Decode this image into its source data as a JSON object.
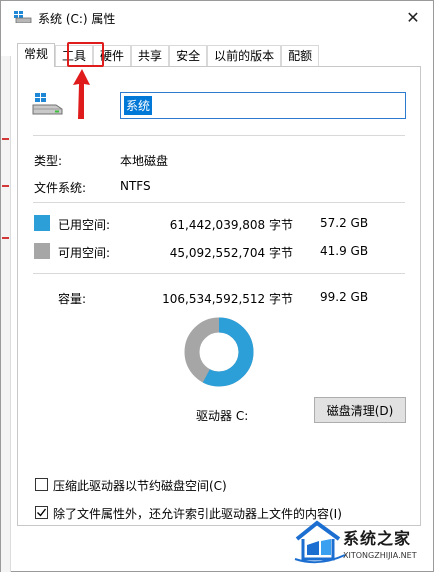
{
  "window": {
    "title": "系统 (C:) 属性",
    "close_symbol": "✕"
  },
  "tabs": [
    {
      "label": "常规",
      "active": true
    },
    {
      "label": "工具",
      "active": false,
      "highlighted": true
    },
    {
      "label": "硬件",
      "active": false
    },
    {
      "label": "共享",
      "active": false
    },
    {
      "label": "安全",
      "active": false
    },
    {
      "label": "以前的版本",
      "active": false
    },
    {
      "label": "配额",
      "active": false
    }
  ],
  "drive": {
    "icon": "drive-icon",
    "name": "系统"
  },
  "info": {
    "type_label": "类型:",
    "type_value": "本地磁盘",
    "fs_label": "文件系统:",
    "fs_value": "NTFS"
  },
  "space": {
    "used_label": "已用空间:",
    "used_bytes": "61,442,039,808 字节",
    "used_gb": "57.2 GB",
    "free_label": "可用空间:",
    "free_bytes": "45,092,552,704 字节",
    "free_gb": "41.9 GB",
    "capacity_label": "容量:",
    "capacity_bytes": "106,534,592,512 字节",
    "capacity_gb": "99.2 GB",
    "used_fraction": 0.577
  },
  "colors": {
    "used": "#2c9ed8",
    "free": "#a6a6a6",
    "highlight": "#e01b1b"
  },
  "drive_label": "驱动器 C:",
  "cleanup_button": "磁盘清理(D)",
  "options": {
    "compress_label": "压缩此驱动器以节约磁盘空间(C)",
    "compress_checked": false,
    "index_label": "除了文件属性外，还允许索引此驱动器上文件的内容(I)",
    "index_checked": true
  },
  "watermark": {
    "title": "系统之家",
    "url": "XITONGZHIJIA.NET"
  }
}
